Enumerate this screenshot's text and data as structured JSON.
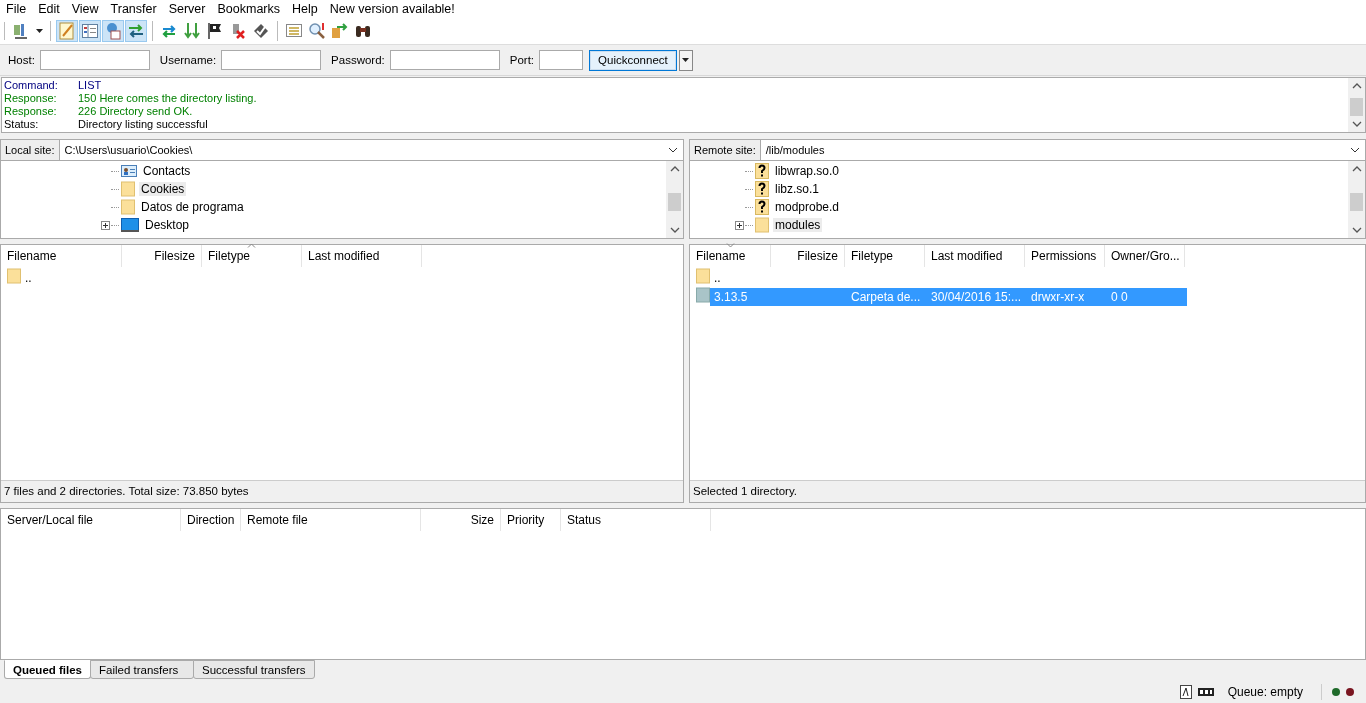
{
  "menu": [
    "File",
    "Edit",
    "View",
    "Transfer",
    "Server",
    "Bookmarks",
    "Help",
    "New version available!"
  ],
  "toolbar": [
    {
      "on": false
    },
    {
      "on": false
    },
    {
      "on": true
    },
    {
      "on": true
    },
    {
      "on": true
    },
    {
      "on": true
    },
    {
      "on": false
    },
    {
      "on": false
    },
    {
      "on": false
    },
    {
      "on": false
    },
    {
      "on": false
    },
    {
      "on": false
    },
    {
      "on": false
    },
    {
      "on": false
    },
    {
      "on": false
    }
  ],
  "quickconnect": {
    "fields": [
      {
        "label": "Host:"
      },
      {
        "label": "Username:"
      },
      {
        "label": "Password:"
      },
      {
        "label": "Port:"
      }
    ],
    "button": "Quickconnect"
  },
  "log": [
    {
      "kind": "command",
      "label": "Command:",
      "text": "LIST"
    },
    {
      "kind": "response",
      "label": "Response:",
      "text": "150 Here comes the directory listing."
    },
    {
      "kind": "response",
      "label": "Response:",
      "text": "226 Directory send OK."
    },
    {
      "kind": "status",
      "label": "Status:",
      "text": "Directory listing successful"
    }
  ],
  "local": {
    "site_label": "Local site:",
    "path": "C:\\Users\\usuario\\Cookies\\",
    "tree": [
      {
        "kind": "contacts",
        "name": "Contacts",
        "selected": false,
        "expandable": false
      },
      {
        "kind": "folder",
        "name": "Cookies",
        "selected": true,
        "expandable": false
      },
      {
        "kind": "folder",
        "name": "Datos de programa",
        "selected": false,
        "expandable": false
      },
      {
        "kind": "desktop",
        "name": "Desktop",
        "selected": false,
        "expandable": true
      }
    ],
    "columns": [
      {
        "label": "Filename",
        "sorted_ascending": false,
        "sorted_descending": false
      },
      {
        "label": "Filesize",
        "sorted_ascending": false,
        "sorted_descending": false
      },
      {
        "label": "Filetype",
        "sorted_ascending": true,
        "sorted_descending": false
      },
      {
        "label": "Last modified",
        "sorted_ascending": false,
        "sorted_descending": false
      }
    ],
    "rows": [
      {
        "kind": "folder",
        "cells": [
          ".."
        ],
        "selected": false
      }
    ],
    "status": "7 files and 2 directories. Total size: 73.850 bytes"
  },
  "remote": {
    "site_label": "Remote site:",
    "path": "/lib/modules",
    "tree": [
      {
        "kind": "unknown",
        "name": "libwrap.so.0",
        "selected": false,
        "expandable": false
      },
      {
        "kind": "unknown",
        "name": "libz.so.1",
        "selected": false,
        "expandable": false
      },
      {
        "kind": "unknown",
        "name": "modprobe.d",
        "selected": false,
        "expandable": false
      },
      {
        "kind": "folder",
        "name": "modules",
        "selected": true,
        "expandable": true
      }
    ],
    "columns": [
      {
        "label": "Filename",
        "sorted_ascending": false,
        "sorted_descending": true
      },
      {
        "label": "Filesize",
        "sorted_ascending": false,
        "sorted_descending": false
      },
      {
        "label": "Filetype",
        "sorted_ascending": false,
        "sorted_descending": false
      },
      {
        "label": "Last modified",
        "sorted_ascending": false,
        "sorted_descending": false
      },
      {
        "label": "Permissions",
        "sorted_ascending": false,
        "sorted_descending": false
      },
      {
        "label": "Owner/Gro...",
        "sorted_ascending": false,
        "sorted_descending": false
      }
    ],
    "rows": [
      {
        "kind": "folder",
        "cells": [
          ".."
        ],
        "selected": false
      },
      {
        "kind": "folder-grey",
        "cells": [
          "3.13.5",
          "",
          "Carpeta de...",
          "30/04/2016 15:...",
          "drwxr-xr-x",
          "0 0"
        ],
        "selected": true
      }
    ],
    "status": "Selected 1 directory."
  },
  "queue": {
    "columns": [
      "Server/Local file",
      "Direction",
      "Remote file",
      "Size",
      "Priority",
      "Status"
    ]
  },
  "tabs": [
    {
      "label": "Queued files",
      "selected": true
    },
    {
      "label": "Failed transfers",
      "selected": false
    },
    {
      "label": "Successful transfers",
      "selected": false
    }
  ],
  "status_bar": {
    "queue": "Queue: empty"
  }
}
